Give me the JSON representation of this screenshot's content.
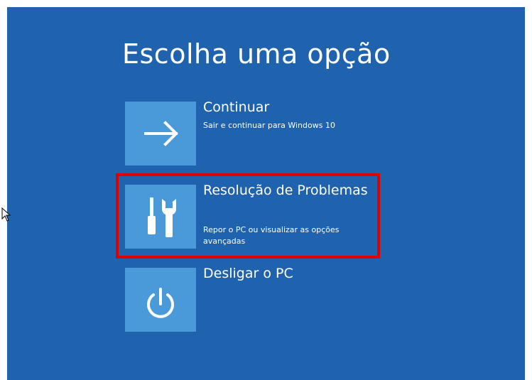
{
  "title": "Escolha uma opção",
  "options": [
    {
      "label": "Continuar",
      "description": "Sair e continuar para Windows 10",
      "icon": "arrow-right-icon"
    },
    {
      "label": "Resolução de Problemas",
      "description": "Repor o PC ou visualizar as opções avançadas",
      "icon": "tools-icon"
    },
    {
      "label": "Desligar o PC",
      "description": "",
      "icon": "power-icon"
    }
  ],
  "colors": {
    "background": "#1f62ad",
    "tile": "#4a9ada",
    "highlight": "#e00000",
    "text": "#ffffff"
  }
}
